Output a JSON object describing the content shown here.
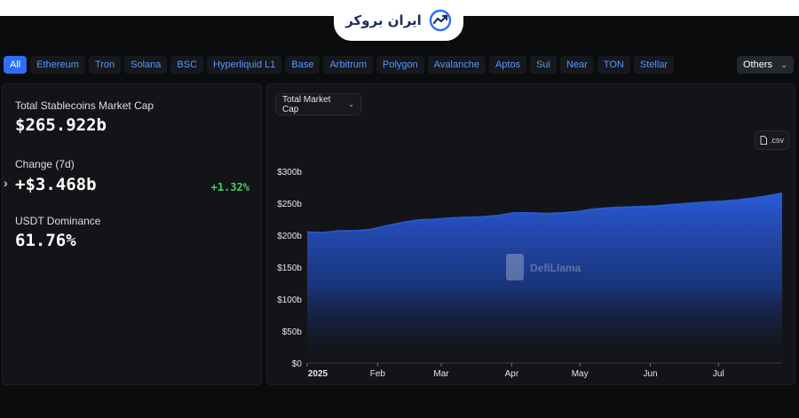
{
  "brand": {
    "name": "ایران بروکر",
    "accent": "#2d6ef5"
  },
  "chains": {
    "items": [
      "All",
      "Ethereum",
      "Tron",
      "Solana",
      "BSC",
      "Hyperliquid L1",
      "Base",
      "Arbitrum",
      "Polygon",
      "Avalanche",
      "Aptos",
      "Sui",
      "Near",
      "TON",
      "Stellar"
    ],
    "active": "All",
    "others_label": "Others"
  },
  "stats": {
    "market_cap_label": "Total Stablecoins Market Cap",
    "market_cap_value": "$265.922b",
    "change_label": "Change (7d)",
    "change_value": "+$3.468b",
    "change_pct": "+1.32%",
    "dominance_label": "USDT Dominance",
    "dominance_value": "61.76%"
  },
  "controls": {
    "metric_label": "Total Market Cap",
    "csv_label": ".csv"
  },
  "watermark": "DefiLlama",
  "colors": {
    "series": "#2a5bd7",
    "positive": "#3fcf6b",
    "link": "#5b95ff"
  },
  "chart_data": {
    "type": "area",
    "title": "",
    "xlabel": "",
    "ylabel": "",
    "ylim": [
      0,
      300
    ],
    "yticks": [
      "$0",
      "$50b",
      "$100b",
      "$150b",
      "$200b",
      "$250b",
      "$300b"
    ],
    "xticks": [
      "2025",
      "Feb",
      "Mar",
      "Apr",
      "May",
      "Jun",
      "Jul"
    ],
    "series": [
      {
        "x": [
          "2025-01-01",
          "2025-01-08",
          "2025-01-15",
          "2025-01-22",
          "2025-01-29",
          "2025-02-05",
          "2025-02-12",
          "2025-02-19",
          "2025-02-26",
          "2025-03-05",
          "2025-03-12",
          "2025-03-19",
          "2025-03-26",
          "2025-04-02",
          "2025-04-09",
          "2025-04-16",
          "2025-04-23",
          "2025-04-30",
          "2025-05-07",
          "2025-05-14",
          "2025-05-21",
          "2025-05-28",
          "2025-06-04",
          "2025-06-11",
          "2025-06-18",
          "2025-06-25",
          "2025-07-02",
          "2025-07-09",
          "2025-07-16",
          "2025-07-23",
          "2025-07-29"
        ],
        "values": [
          205,
          204,
          207,
          207,
          209,
          215,
          220,
          224,
          225,
          227,
          228,
          229,
          231,
          235,
          235,
          234,
          235,
          237,
          241,
          243,
          244,
          245,
          246,
          248,
          250,
          252,
          253,
          255,
          258,
          262,
          266
        ]
      }
    ]
  }
}
